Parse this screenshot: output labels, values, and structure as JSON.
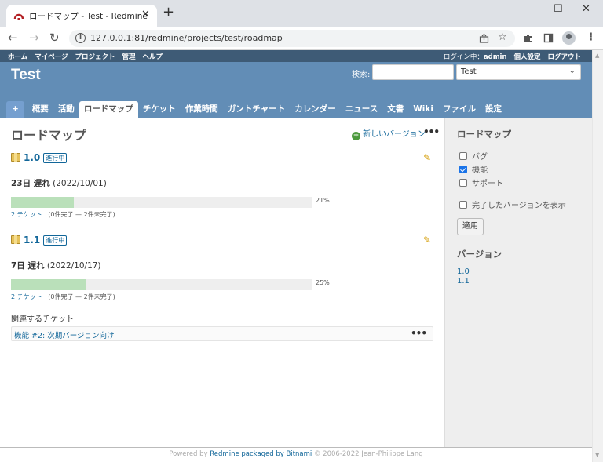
{
  "browser": {
    "tab_title": "ロードマップ - Test - Redmine",
    "tab_close": "✕",
    "new_tab": "+",
    "url": "127.0.0.1:81/redmine/projects/test/roadmap",
    "win_minimize": "—",
    "win_maximize": "☐",
    "win_close": "✕",
    "icons": [
      "back-icon",
      "forward-icon",
      "reload-icon",
      "info-icon",
      "share-icon",
      "bookmark-star-icon",
      "extensions-icon",
      "side-panel-icon",
      "profile-icon",
      "menu-icon"
    ]
  },
  "top_menu": {
    "items": [
      "ホーム",
      "マイページ",
      "プロジェクト",
      "管理",
      "ヘルプ"
    ],
    "logged_in_label": "ログイン中：",
    "user": "admin",
    "my_account": "個人設定",
    "logout": "ログアウト"
  },
  "header": {
    "project_title": "Test",
    "search_label": "検索:",
    "search_value": "",
    "jump_value": "Test"
  },
  "main_menu": {
    "new": "+",
    "tabs": [
      "概要",
      "活動",
      "ロードマップ",
      "チケット",
      "作業時間",
      "ガントチャート",
      "カレンダー",
      "ニュース",
      "文書",
      "Wiki",
      "ファイル",
      "設定"
    ],
    "active_tab": "ロードマップ"
  },
  "content": {
    "title": "ロードマップ",
    "new_version": "新しいバージョン",
    "more": "•••",
    "versions": [
      {
        "name": "1.0",
        "status": "進行中",
        "late": "23日 遅れ",
        "date": "(2022/10/01)",
        "progress_pct": 21,
        "pct_label": "21%",
        "tickets_link": "2 チケット",
        "counts": "(0件完了 — 2件未完了)"
      },
      {
        "name": "1.1",
        "status": "進行中",
        "late": "7日 遅れ",
        "date": "(2022/10/17)",
        "progress_pct": 25,
        "pct_label": "25%",
        "tickets_link": "2 チケット",
        "counts": "(0件完了 — 2件未完了)"
      }
    ],
    "related_title": "関連するチケット",
    "related_issue": "機能 #2: 次期バージョン向け",
    "related_more": "•••"
  },
  "sidebar": {
    "roadmap_heading": "ロードマップ",
    "trackers": [
      {
        "label": "バグ",
        "checked": false
      },
      {
        "label": "機能",
        "checked": true
      },
      {
        "label": "サポート",
        "checked": false
      }
    ],
    "show_completed": {
      "label": "完了したバージョンを表示",
      "checked": false
    },
    "apply": "適用",
    "versions_heading": "バージョン",
    "version_links": [
      "1.0",
      "1.1"
    ]
  },
  "footer": {
    "powered_by": "Powered by",
    "redmine": "Redmine",
    "packaged": "packaged by Bitnami",
    "copyright": "© 2006-2022 Jean-Philippe Lang"
  },
  "colors": {
    "header_bg": "#628db6",
    "top_menu_bg": "#3e5b76",
    "link": "#116699",
    "progress_done": "#bae0ba",
    "progress_todo": "#eeeeee",
    "sidebar_bg": "#eeeeee"
  }
}
